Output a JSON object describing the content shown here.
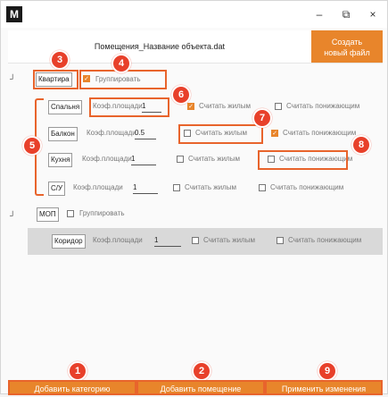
{
  "window": {
    "app_icon": "M",
    "controls": [
      "–",
      "⧉",
      "×"
    ]
  },
  "header": {
    "filename": "Помещения_Название объекта.dat",
    "create_button": [
      "Создать",
      "новый файл"
    ]
  },
  "tree": {
    "collapse_marker": "┘",
    "group_label": "Группировать",
    "category1": {
      "name": "Квартира",
      "group_checked": true
    },
    "category2": {
      "name": "МОП",
      "group_checked": false
    },
    "coef_label": "Коэф.площади",
    "living_label": "Считать жилым",
    "reducing_label": "Считать понижающим",
    "rooms": [
      {
        "name": "Спальня",
        "coef": "1",
        "living": true,
        "reducing": false
      },
      {
        "name": "Балкон",
        "coef": "0.5",
        "living": false,
        "reducing": true
      },
      {
        "name": "Кухня",
        "coef": "1",
        "living": false,
        "reducing": false
      },
      {
        "name": "С/У",
        "coef": "1",
        "living": false,
        "reducing": false
      }
    ],
    "mop_rooms": [
      {
        "name": "Коридор",
        "coef": "1",
        "living": false,
        "reducing": false
      }
    ]
  },
  "badges": [
    "1",
    "2",
    "3",
    "4",
    "5",
    "6",
    "7",
    "8",
    "9"
  ],
  "buttons": {
    "add_category": "Добавить категорию",
    "add_room": "Добавить помещение",
    "apply": "Применить изменения"
  },
  "colors": {
    "accent": "#e8852b",
    "highlight": "#e8642c",
    "badge": "#e8402a"
  }
}
